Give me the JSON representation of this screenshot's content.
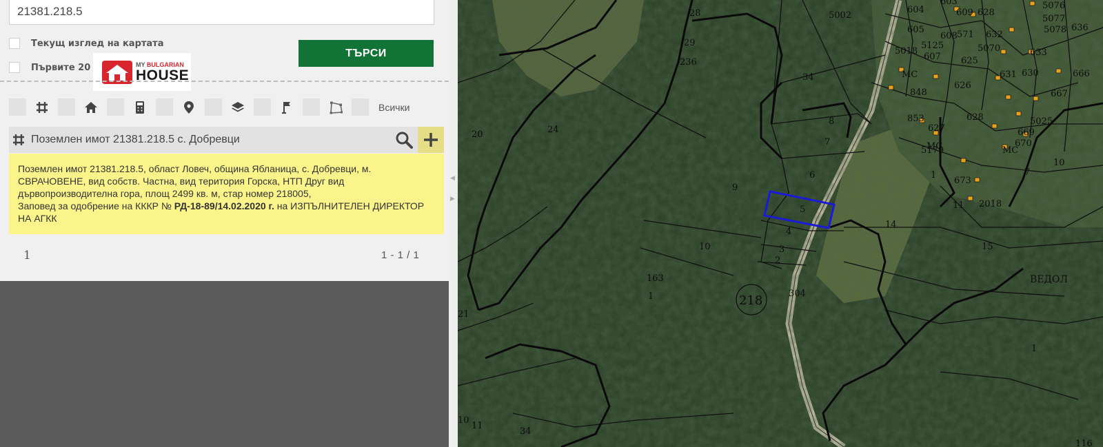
{
  "search": {
    "value": "21381.218.5"
  },
  "options": {
    "current_view_label": "Текущ изглед на картата",
    "first_label": "Първите 20"
  },
  "search_button": "ТЪРСИ",
  "logo": {
    "line1_a": "MY ",
    "line1_b": "BULGARIAN",
    "line2": "HOUSE"
  },
  "filters": {
    "icons": [
      "grid-icon",
      "home-icon",
      "calculator-icon",
      "pin-icon",
      "layers-icon",
      "flag-icon",
      "polygon-icon"
    ],
    "all_label": "Всички"
  },
  "result": {
    "title": "Поземлен имот 21381.218.5 с. Добревци",
    "info_part1": "Поземлен имот 21381.218.5, област Ловеч, община Ябланица, с. Добревци, м. СВРАЧОВЕНЕ, вид собств. Частна, вид територия Горска, НТП Друг вид дървопроизводителна гора, площ 2499 кв. м, стар номер 218005,",
    "info_part2": "Заповед за одобрение на КККР №",
    "info_bold": "РД-18-89/14.02.2020 г.",
    "info_part3": "на ИЗПЪЛНИТЕЛЕН ДИРЕКТОР НА АГКК"
  },
  "pagination": {
    "page": "1",
    "range": "1 - 1 / 1"
  },
  "map": {
    "selected_parcel": "5",
    "block_number": "218",
    "locality_label": "ВЕДОЛ",
    "colors": {
      "highlight": "#1b1bd6",
      "building": "#e8a21b",
      "forest": "#23381f"
    },
    "labels": [
      {
        "id": "l28",
        "t": "28"
      },
      {
        "id": "l29",
        "t": "29"
      },
      {
        "id": "l236",
        "t": "236"
      },
      {
        "id": "l34a",
        "t": "34"
      },
      {
        "id": "l5002",
        "t": "5002"
      },
      {
        "id": "l604",
        "t": "604"
      },
      {
        "id": "l605",
        "t": "605"
      },
      {
        "id": "l603",
        "t": "603"
      },
      {
        "id": "l609",
        "t": "609"
      },
      {
        "id": "l628",
        "t": "628"
      },
      {
        "id": "l5076",
        "t": "5076"
      },
      {
        "id": "l5077",
        "t": "5077"
      },
      {
        "id": "l5078",
        "t": "5078"
      },
      {
        "id": "l636",
        "t": "636"
      },
      {
        "id": "l608",
        "t": "608"
      },
      {
        "id": "l571",
        "t": "571"
      },
      {
        "id": "l632",
        "t": "632"
      },
      {
        "id": "l5018",
        "t": "5018"
      },
      {
        "id": "l5125",
        "t": "5125"
      },
      {
        "id": "l5070",
        "t": "5070"
      },
      {
        "id": "l633",
        "t": "633"
      },
      {
        "id": "l607",
        "t": "607"
      },
      {
        "id": "l625",
        "t": "625"
      },
      {
        "id": "l631",
        "t": "631"
      },
      {
        "id": "l630",
        "t": "630"
      },
      {
        "id": "l666",
        "t": "666"
      },
      {
        "id": "l848",
        "t": "848"
      },
      {
        "id": "l626",
        "t": "626"
      },
      {
        "id": "l667",
        "t": "667"
      },
      {
        "id": "l853",
        "t": "853"
      },
      {
        "id": "l628b",
        "t": "628"
      },
      {
        "id": "l627",
        "t": "627"
      },
      {
        "id": "l5179",
        "t": "5179"
      },
      {
        "id": "l5025",
        "t": "5025"
      },
      {
        "id": "l669",
        "t": "669"
      },
      {
        "id": "l670",
        "t": "670"
      },
      {
        "id": "l1a",
        "t": "1"
      },
      {
        "id": "l673",
        "t": "673"
      },
      {
        "id": "l7a",
        "t": "7"
      },
      {
        "id": "l10a",
        "t": "10"
      },
      {
        "id": "l11a",
        "t": "11"
      },
      {
        "id": "l2018",
        "t": "2018"
      },
      {
        "id": "l8",
        "t": "8"
      },
      {
        "id": "l7",
        "t": "7"
      },
      {
        "id": "l6",
        "t": "6"
      },
      {
        "id": "l9",
        "t": "9"
      },
      {
        "id": "l4",
        "t": "4"
      },
      {
        "id": "l3",
        "t": "3"
      },
      {
        "id": "l2",
        "t": "2"
      },
      {
        "id": "l10",
        "t": "10"
      },
      {
        "id": "l163",
        "t": "163"
      },
      {
        "id": "l1b",
        "t": "1"
      },
      {
        "id": "l304",
        "t": "304"
      },
      {
        "id": "l14",
        "t": "14"
      },
      {
        "id": "l15",
        "t": "15"
      },
      {
        "id": "l1c",
        "t": "1"
      },
      {
        "id": "l20",
        "t": "20"
      },
      {
        "id": "l24",
        "t": "24"
      },
      {
        "id": "l21",
        "t": "21"
      },
      {
        "id": "l10b",
        "t": "10"
      },
      {
        "id": "l11b",
        "t": "11"
      },
      {
        "id": "l34b",
        "t": "34"
      },
      {
        "id": "l116",
        "t": "116"
      },
      {
        "id": "lmc1",
        "t": "МС"
      },
      {
        "id": "lmc2",
        "t": "МС"
      },
      {
        "id": "lmc3",
        "t": "МС"
      }
    ]
  }
}
